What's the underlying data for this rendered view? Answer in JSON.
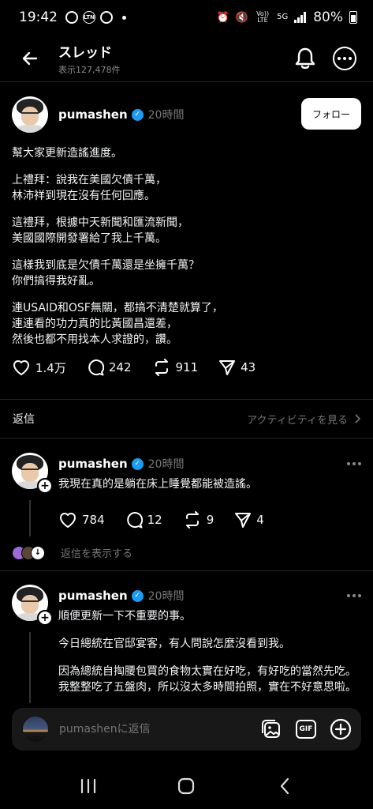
{
  "status_bar": {
    "time": "19:42",
    "ltn_label": "LTN",
    "lte_label": "Vo)) LTE",
    "network": "5G",
    "battery": "80%"
  },
  "header": {
    "title": "スレッド",
    "subtitle": "表示127,478件"
  },
  "post": {
    "author": "pumashen",
    "verified_mark": "✓",
    "time": "20時間",
    "follow_label": "フォロー",
    "paragraphs": [
      "幫大家更新造謠進度。",
      "上禮拜：說我在美國欠債千萬，\n林沛祥到現在沒有任何回應。",
      "這禮拜，根據中天新聞和匯流新聞，\n美國國際開發署給了我上千萬。",
      "這樣我到底是欠債千萬還是坐擁千萬？\n你們搞得我好亂。",
      "連USAID和OSF無關，都搞不清楚就算了，\n連連看的功力真的比黃國昌還差，\n然後也都不用找本人求證的，讚。"
    ],
    "likes": "1.4万",
    "comments": "242",
    "reposts": "911",
    "shares": "43"
  },
  "replies_bar": {
    "label": "返信",
    "activity_link": "アクティビティを見る"
  },
  "reply1": {
    "author": "pumashen",
    "time": "20時間",
    "text": "我現在真的是躺在床上睡覺都能被造謠。",
    "likes": "784",
    "comments": "12",
    "reposts": "9",
    "shares": "4"
  },
  "show_replies": {
    "label": "返信を表示する"
  },
  "reply2": {
    "author": "pumashen",
    "time": "20時間",
    "paragraphs": [
      "順便更新一下不重要的事。",
      "今日總統在官邸宴客，有人問說怎麼沒看到我。",
      "因為總統自掏腰包買的食物太實在好吃，有好吃的當然先吃。我整整吃了五盤肉，所以沒太多時間拍照，實在不好意思啦。"
    ]
  },
  "composer": {
    "placeholder": "pumashenに返信",
    "gif_label": "GIF"
  },
  "colors": {
    "background": "#000000",
    "verified": "#1d9bf0",
    "muted_text": "#777777"
  }
}
